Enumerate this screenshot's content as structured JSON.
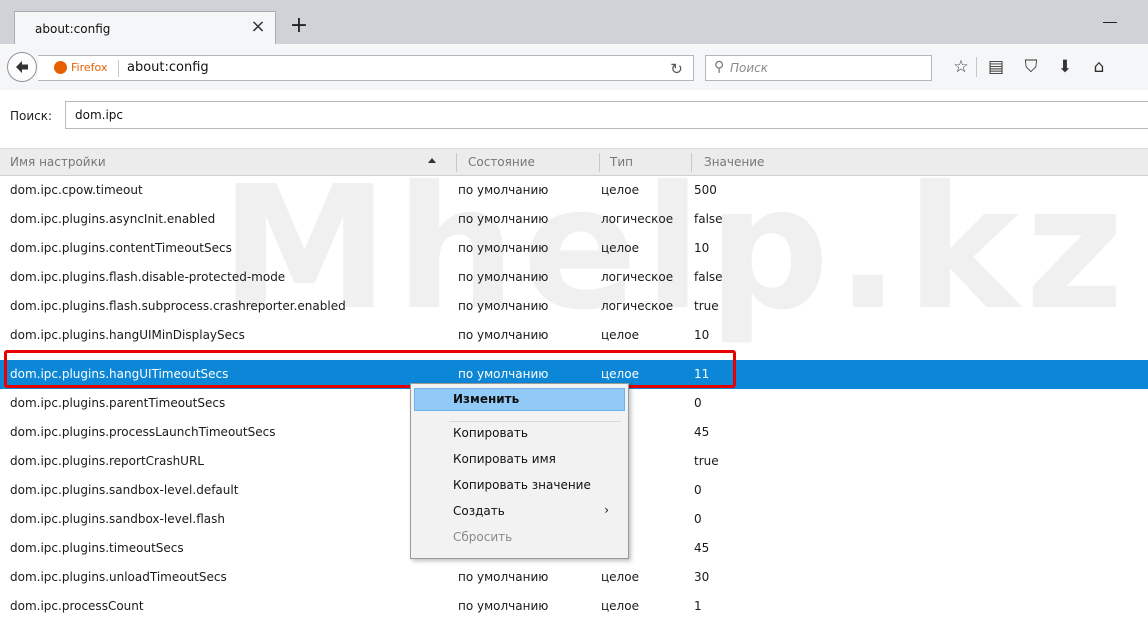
{
  "tab": {
    "title": "about:config"
  },
  "navbar": {
    "identity_label": "Firefox",
    "url": "about:config",
    "search_placeholder": "Поиск"
  },
  "filter": {
    "label": "Поиск:",
    "value": "dom.ipc"
  },
  "columns": [
    "Имя настройки",
    "Состояние",
    "Тип",
    "Значение"
  ],
  "rows": [
    {
      "name": "dom.ipc.cpow.timeout",
      "state": "по умолчанию",
      "type": "целое",
      "value": "500"
    },
    {
      "name": "dom.ipc.plugins.asyncInit.enabled",
      "state": "по умолчанию",
      "type": "логическое",
      "value": "false"
    },
    {
      "name": "dom.ipc.plugins.contentTimeoutSecs",
      "state": "по умолчанию",
      "type": "целое",
      "value": "10"
    },
    {
      "name": "dom.ipc.plugins.flash.disable-protected-mode",
      "state": "по умолчанию",
      "type": "логическое",
      "value": "false"
    },
    {
      "name": "dom.ipc.plugins.flash.subprocess.crashreporter.enabled",
      "state": "по умолчанию",
      "type": "логическое",
      "value": "true"
    },
    {
      "name": "dom.ipc.plugins.hangUIMinDisplaySecs",
      "state": "по умолчанию",
      "type": "целое",
      "value": "10"
    },
    {
      "name": "dom.ipc.plugins.hangUITimeoutSecs",
      "state": "по умолчанию",
      "type": "целое",
      "value": "11",
      "selected": true
    },
    {
      "name": "dom.ipc.plugins.parentTimeoutSecs",
      "state": "",
      "type": "",
      "value": "0"
    },
    {
      "name": "dom.ipc.plugins.processLaunchTimeoutSecs",
      "state": "",
      "type": "",
      "value": "45"
    },
    {
      "name": "dom.ipc.plugins.reportCrashURL",
      "state": "",
      "type": "",
      "value": "true"
    },
    {
      "name": "dom.ipc.plugins.sandbox-level.default",
      "state": "",
      "type": "",
      "value": "0"
    },
    {
      "name": "dom.ipc.plugins.sandbox-level.flash",
      "state": "",
      "type": "",
      "value": "0"
    },
    {
      "name": "dom.ipc.plugins.timeoutSecs",
      "state": "",
      "type": "",
      "value": "45"
    },
    {
      "name": "dom.ipc.plugins.unloadTimeoutSecs",
      "state": "по умолчанию",
      "type": "целое",
      "value": "30"
    },
    {
      "name": "dom.ipc.processCount",
      "state": "по умолчанию",
      "type": "целое",
      "value": "1"
    }
  ],
  "context_menu": {
    "items": [
      "Изменить",
      "Копировать",
      "Копировать имя",
      "Копировать значение",
      "Создать",
      "Сбросить"
    ]
  },
  "watermark": "Mhelp.kz",
  "colors": {
    "selected_row": "#0c86d6",
    "highlight_border": "#e60000",
    "menu_hover": "#91c9f7"
  }
}
